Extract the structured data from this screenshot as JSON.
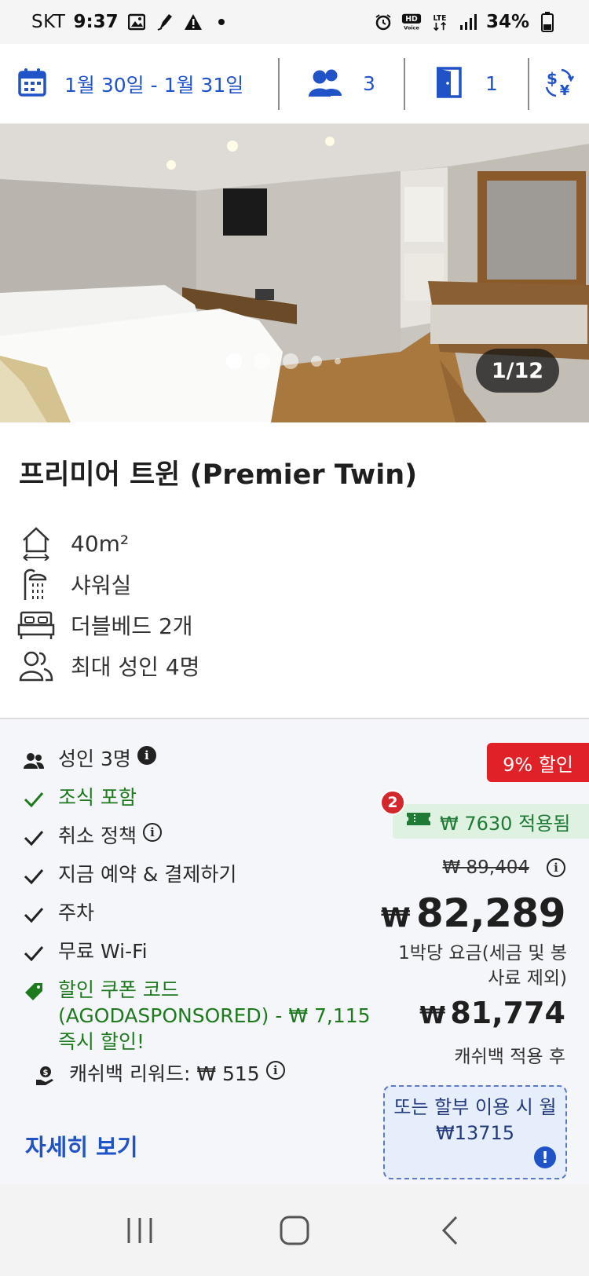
{
  "status_bar": {
    "carrier": "SKT",
    "time": "9:37",
    "battery": "34%",
    "network": "LTE"
  },
  "search": {
    "dates": "1월 30일 - 1월 31일",
    "guests": "3",
    "rooms": "1"
  },
  "gallery": {
    "counter": "1/12",
    "dot_count": 5,
    "active_index": 0
  },
  "room": {
    "title": "프리미어 트윈 (Premier Twin)",
    "features": [
      {
        "icon": "room-size-icon",
        "label": "40m²"
      },
      {
        "icon": "shower-icon",
        "label": "샤워실"
      },
      {
        "icon": "bed-icon",
        "label": "더블베드 2개"
      },
      {
        "icon": "occupancy-icon",
        "label": "최대 성인 4명"
      }
    ]
  },
  "offer": {
    "adults": "성인 3명",
    "breakfast": "조식 포함",
    "cancellation": "취소 정책",
    "book_now": "지금 예약 & 결제하기",
    "parking": "주차",
    "wifi": "무료 Wi-Fi",
    "coupon_code": "할인 쿠폰 코드 (AGODASPONSORED) - ₩ 7,115 즉시 할인!",
    "cashback_reward": "캐쉬백 리워드: ₩ 515",
    "more_link": "자세히 보기",
    "discount_badge": "9% 할인",
    "coupon_count": "2",
    "coupon_applied": "₩ 7630 적용됨",
    "original_price": "₩ 89,404",
    "currency_symbol": "₩",
    "price": "82,289",
    "price_note": "1박당 요금(세금 및 봉사료 제외)",
    "cashback_price": "81,774",
    "cashback_note": "캐쉬백 적용 후",
    "installment": "또는 할부 이용 시 월 ₩13715"
  },
  "colors": {
    "brand_blue": "#2052c8",
    "discount_red": "#e02127",
    "success_green": "#1e7a35"
  }
}
